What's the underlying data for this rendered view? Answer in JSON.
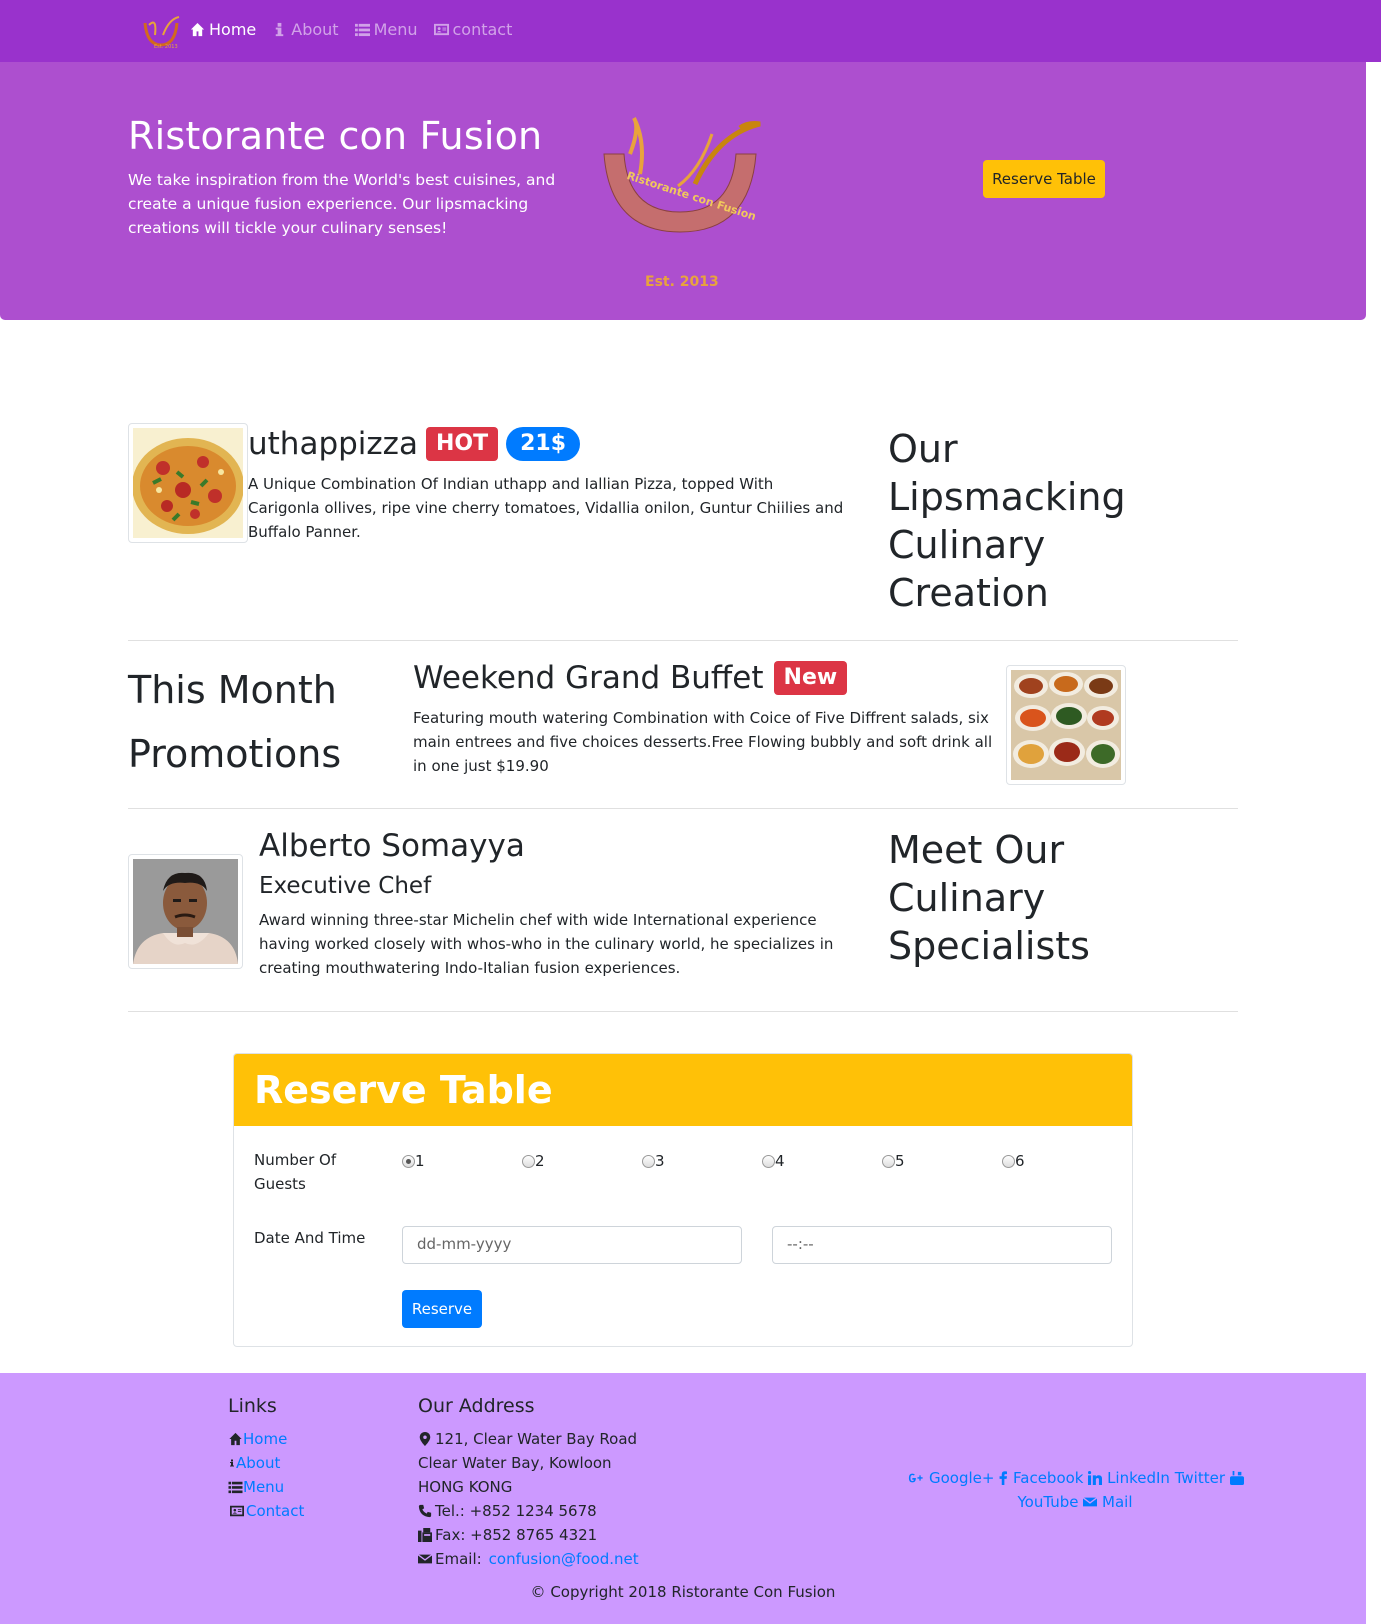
{
  "nav": {
    "items": [
      {
        "label": "Home",
        "icon": "home-icon"
      },
      {
        "label": "About",
        "icon": "info-icon"
      },
      {
        "label": "Menu",
        "icon": "list-icon"
      },
      {
        "label": "contact",
        "icon": "address-card-icon"
      }
    ]
  },
  "jumbotron": {
    "title": "Ristorante con Fusion",
    "text": "We take inspiration from the World's best cuisines, and create a unique fusion experience. Our lipsmacking creations will tickle your culinary senses!",
    "logo_text": "Ristorante con Fusion",
    "logo_est": "Est. 2013",
    "reserve_button": "Reserve Table"
  },
  "dish": {
    "name": "uthappizza",
    "badge_hot": "HOT",
    "price": "21$",
    "description": "A Unique Combination Of Indian uthapp and Iallian Pizza, topped With Carigonla ollives, ripe vine cherry tomatoes, Vidallia onilon, Guntur Chiilies and Buffalo Panner.",
    "side_heading": "Our Lipsmacking Culinary Creation"
  },
  "promotion": {
    "side_heading": "This Month Promotions",
    "name": "Weekend Grand Buffet",
    "badge": "New",
    "description": "Featuring mouth watering Combination with Coice of Five Diffrent salads, six main entrees and five choices desserts.Free Flowing bubbly and soft drink all in one just $19.90"
  },
  "chef": {
    "name": "Alberto Somayya",
    "title": "Executive Chef",
    "description": "Award winning three-star Michelin chef with wide International experience having worked closely with whos-who in the culinary world, he specializes in creating mouthwatering Indo-Italian fusion experiences.",
    "side_heading": "Meet Our Culinary Specialists"
  },
  "reserve": {
    "title": "Reserve Table",
    "guests_label": "Number Of Guests",
    "guest_options": [
      "1",
      "2",
      "3",
      "4",
      "5",
      "6"
    ],
    "selected_guests": "1",
    "date_time_label": "Date And Time",
    "date_placeholder": "dd-mm-yyyy",
    "time_placeholder": "--:--",
    "submit": "Reserve"
  },
  "footer": {
    "links_heading": "Links",
    "links": [
      "Home",
      "About",
      "Menu",
      "Contact"
    ],
    "address_heading": "Our Address",
    "address_line1": "121, Clear Water Bay Road",
    "address_line2": "Clear Water Bay, Kowloon",
    "address_line3": "HONG KONG",
    "tel": "Tel.: +852 1234 5678",
    "fax": "Fax: +852 8765 4321",
    "email_label": "Email:",
    "email": "confusion@food.net",
    "social": [
      "Google+",
      "Facebook",
      "LinkedIn",
      "Twitter",
      "YouTube",
      "Mail"
    ],
    "copyright": "© Copyright 2018 Ristorante Con Fusion"
  },
  "colors": {
    "navbar": "#9932cc",
    "jumbotron": "#ad4fcf",
    "warning": "#ffc107",
    "primary": "#007bff",
    "danger": "#dc3545",
    "footer": "#cc99ff"
  }
}
